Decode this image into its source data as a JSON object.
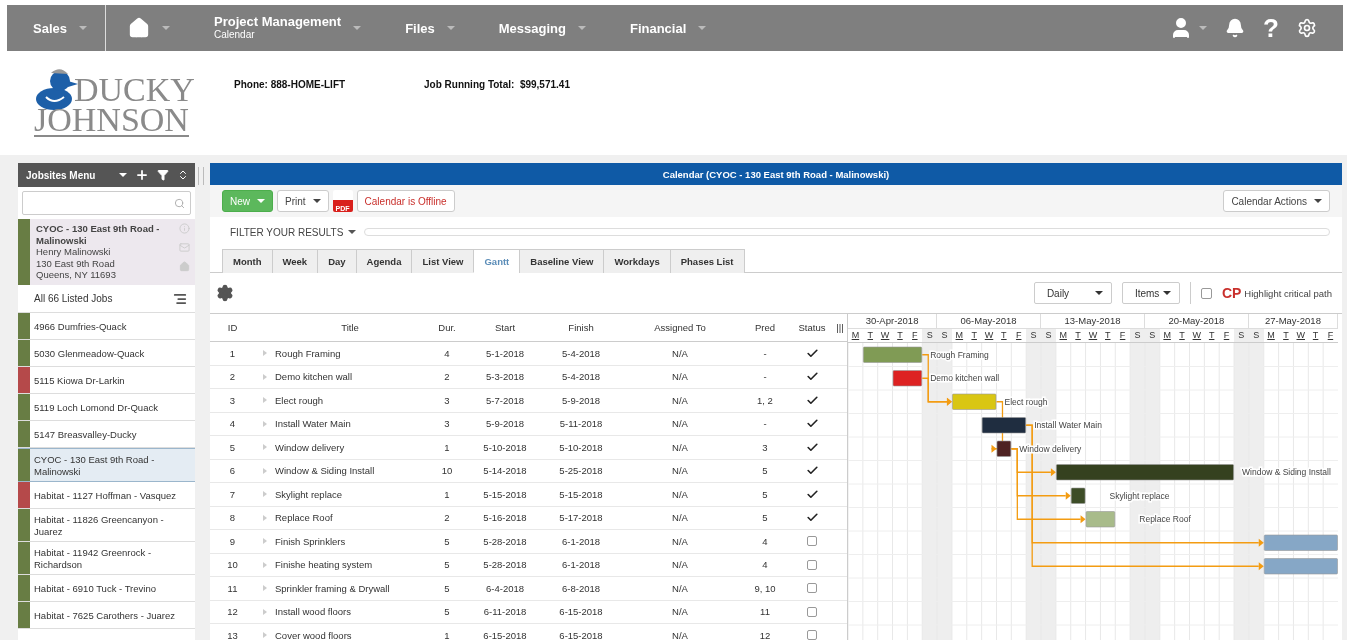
{
  "nav": {
    "items": [
      {
        "kind": "text",
        "label": "Sales"
      },
      {
        "kind": "home"
      },
      {
        "kind": "text",
        "label": "Project Management",
        "sublabel": "Calendar"
      },
      {
        "kind": "text",
        "label": "Files"
      },
      {
        "kind": "text",
        "label": "Messaging"
      },
      {
        "kind": "text",
        "label": "Financial"
      }
    ],
    "help": "?"
  },
  "header": {
    "logo_top": "DUCKY",
    "logo_bottom": "JOHNSON",
    "phone": "Phone: 888-HOME-LIFT",
    "total": "Job Running Total:  $99,571.41"
  },
  "sidebar": {
    "title": "Jobsites Menu",
    "current": {
      "title": "CYOC - 130 East 9th Road - Malinowski",
      "lines": [
        "Henry Malinowski",
        "130 East 9th Road",
        "Queens, NY 11693"
      ],
      "color": "#687d44"
    },
    "all_jobs": "All 66 Listed Jobs",
    "jobs": [
      {
        "name": "4966 Dumfries-Quack",
        "color": "#687d44",
        "selected": false
      },
      {
        "name": "5030 Glenmeadow-Quack",
        "color": "#687d44",
        "selected": false
      },
      {
        "name": "5115 Kiowa Dr-Larkin",
        "color": "#b5494a",
        "selected": false
      },
      {
        "name": "5119 Loch Lomond Dr-Quack",
        "color": "#687d44",
        "selected": false
      },
      {
        "name": "5147 Breasvalley-Ducky",
        "color": "#687d44",
        "selected": false
      },
      {
        "name": "CYOC - 130 East 9th Road - Malinowski",
        "color": "#687d44",
        "selected": true
      },
      {
        "name": "Habitat - 1127 Hoffman - Vasquez",
        "color": "#b5494a",
        "selected": false
      },
      {
        "name": "Habitat - 11826 Greencanyon - Juarez",
        "color": "#687d44",
        "selected": false
      },
      {
        "name": "Habitat - 11942 Greenrock - Richardson",
        "color": "#687d44",
        "selected": false
      },
      {
        "name": "Habitat - 6910 Tuck - Trevino",
        "color": "#687d44",
        "selected": false
      },
      {
        "name": "Habitat - 7625 Carothers - Juarez",
        "color": "#687d44",
        "selected": false
      }
    ]
  },
  "panel": {
    "title": "Calendar (CYOC - 130 East 9th Road - Malinowski)",
    "new": "New",
    "print": "Print",
    "pdf": "PDF",
    "offline": "Calendar is Offline",
    "actions": "Calendar Actions",
    "filter": "FILTER YOUR RESULTS",
    "tabs": [
      {
        "label": "Month",
        "selected": false
      },
      {
        "label": "Week",
        "selected": false
      },
      {
        "label": "Day",
        "selected": false
      },
      {
        "label": "Agenda",
        "selected": false
      },
      {
        "label": "List View",
        "selected": false
      },
      {
        "label": "Gantt",
        "selected": true
      },
      {
        "label": "Baseline View",
        "selected": false
      },
      {
        "label": "Workdays",
        "selected": false
      },
      {
        "label": "Phases List",
        "selected": false
      }
    ],
    "scale": "Daily",
    "items": "Items",
    "cp": "CP",
    "cp_label": "Highlight critical path",
    "critical_path": false,
    "columns": [
      "ID",
      "Title",
      "Dur.",
      "Start",
      "Finish",
      "Assigned To",
      "Pred",
      "Status"
    ],
    "splitter": "|||",
    "tasks": [
      {
        "id": "1",
        "title": "Rough Framing",
        "dur": "4",
        "start": "5-1-2018",
        "finish": "5-4-2018",
        "assigned": "N/A",
        "pred": "-",
        "done": true,
        "color": "#809b55",
        "bar_label": "Rough Framing"
      },
      {
        "id": "2",
        "title": "Demo kitchen wall",
        "dur": "2",
        "start": "5-3-2018",
        "finish": "5-4-2018",
        "assigned": "N/A",
        "pred": "-",
        "done": true,
        "color": "#dd2222",
        "bar_label": "Demo kitchen wall"
      },
      {
        "id": "3",
        "title": "Elect rough",
        "dur": "3",
        "start": "5-7-2018",
        "finish": "5-9-2018",
        "assigned": "N/A",
        "pred": "1, 2",
        "done": true,
        "color": "#d9c613",
        "bar_label": "Elect rough"
      },
      {
        "id": "4",
        "title": "Install Water Main",
        "dur": "3",
        "start": "5-9-2018",
        "finish": "5-11-2018",
        "assigned": "N/A",
        "pred": "-",
        "done": true,
        "color": "#1f2d40",
        "bar_label": "Install Water Main"
      },
      {
        "id": "5",
        "title": "Window delivery",
        "dur": "1",
        "start": "5-10-2018",
        "finish": "5-10-2018",
        "assigned": "N/A",
        "pred": "3",
        "done": true,
        "color": "#4e2222",
        "bar_label": "Window delivery"
      },
      {
        "id": "6",
        "title": "Window & Siding Install",
        "dur": "10",
        "start": "5-14-2018",
        "finish": "5-25-2018",
        "assigned": "N/A",
        "pred": "5",
        "done": true,
        "color": "#35411f",
        "bar_label": "Window & Siding Install"
      },
      {
        "id": "7",
        "title": "Skylight replace",
        "dur": "1",
        "start": "5-15-2018",
        "finish": "5-15-2018",
        "assigned": "N/A",
        "pred": "5",
        "done": true,
        "color": "#3d4d27",
        "bar_label": "Skylight replace"
      },
      {
        "id": "8",
        "title": "Replace Roof",
        "dur": "2",
        "start": "5-16-2018",
        "finish": "5-17-2018",
        "assigned": "N/A",
        "pred": "5",
        "done": true,
        "color": "#a8bb8a",
        "bar_label": "Replace Roof"
      },
      {
        "id": "9",
        "title": "Finish Sprinklers",
        "dur": "5",
        "start": "5-28-2018",
        "finish": "6-1-2018",
        "assigned": "N/A",
        "pred": "4",
        "done": false,
        "color": "#86a7c6"
      },
      {
        "id": "10",
        "title": "Finishe heating system",
        "dur": "5",
        "start": "5-28-2018",
        "finish": "6-1-2018",
        "assigned": "N/A",
        "pred": "4",
        "done": false,
        "color": "#86a7c6"
      },
      {
        "id": "11",
        "title": "Sprinkler framing & Drywall",
        "dur": "5",
        "start": "6-4-2018",
        "finish": "6-8-2018",
        "assigned": "N/A",
        "pred": "9, 10",
        "done": false
      },
      {
        "id": "12",
        "title": "Install wood floors",
        "dur": "5",
        "start": "6-11-2018",
        "finish": "6-15-2018",
        "assigned": "N/A",
        "pred": "11",
        "done": false
      },
      {
        "id": "13",
        "title": "Cover wood floors",
        "dur": "1",
        "start": "6-15-2018",
        "finish": "6-15-2018",
        "assigned": "N/A",
        "pred": "12",
        "done": false
      }
    ],
    "gantt": {
      "weeks": [
        {
          "label": "30-Apr-2018",
          "days": [
            {
              "letter": "M",
              "weekend": false
            },
            {
              "letter": "T",
              "weekend": false
            },
            {
              "letter": "W",
              "weekend": false
            },
            {
              "letter": "T",
              "weekend": false
            },
            {
              "letter": "F",
              "weekend": false
            },
            {
              "letter": "S",
              "weekend": true
            }
          ]
        },
        {
          "label": "06-May-2018",
          "days": [
            {
              "letter": "S",
              "weekend": true
            },
            {
              "letter": "M",
              "weekend": false
            },
            {
              "letter": "T",
              "weekend": false
            },
            {
              "letter": "W",
              "weekend": false
            },
            {
              "letter": "T",
              "weekend": false
            },
            {
              "letter": "F",
              "weekend": false
            },
            {
              "letter": "S",
              "weekend": true
            }
          ]
        },
        {
          "label": "13-May-2018",
          "days": [
            {
              "letter": "S",
              "weekend": true
            },
            {
              "letter": "M",
              "weekend": false
            },
            {
              "letter": "T",
              "weekend": false
            },
            {
              "letter": "W",
              "weekend": false
            },
            {
              "letter": "T",
              "weekend": false
            },
            {
              "letter": "F",
              "weekend": false
            },
            {
              "letter": "S",
              "weekend": true
            }
          ]
        },
        {
          "label": "20-May-2018",
          "days": [
            {
              "letter": "S",
              "weekend": true
            },
            {
              "letter": "M",
              "weekend": false
            },
            {
              "letter": "T",
              "weekend": false
            },
            {
              "letter": "W",
              "weekend": false
            },
            {
              "letter": "T",
              "weekend": false
            },
            {
              "letter": "F",
              "weekend": false
            },
            {
              "letter": "S",
              "weekend": true
            }
          ]
        },
        {
          "label": "27-May-2018",
          "days": [
            {
              "letter": "S",
              "weekend": true
            },
            {
              "letter": "M",
              "weekend": false
            },
            {
              "letter": "T",
              "weekend": false
            },
            {
              "letter": "W",
              "weekend": false
            },
            {
              "letter": "T",
              "weekend": false
            },
            {
              "letter": "F",
              "weekend": false
            }
          ]
        }
      ]
    }
  }
}
